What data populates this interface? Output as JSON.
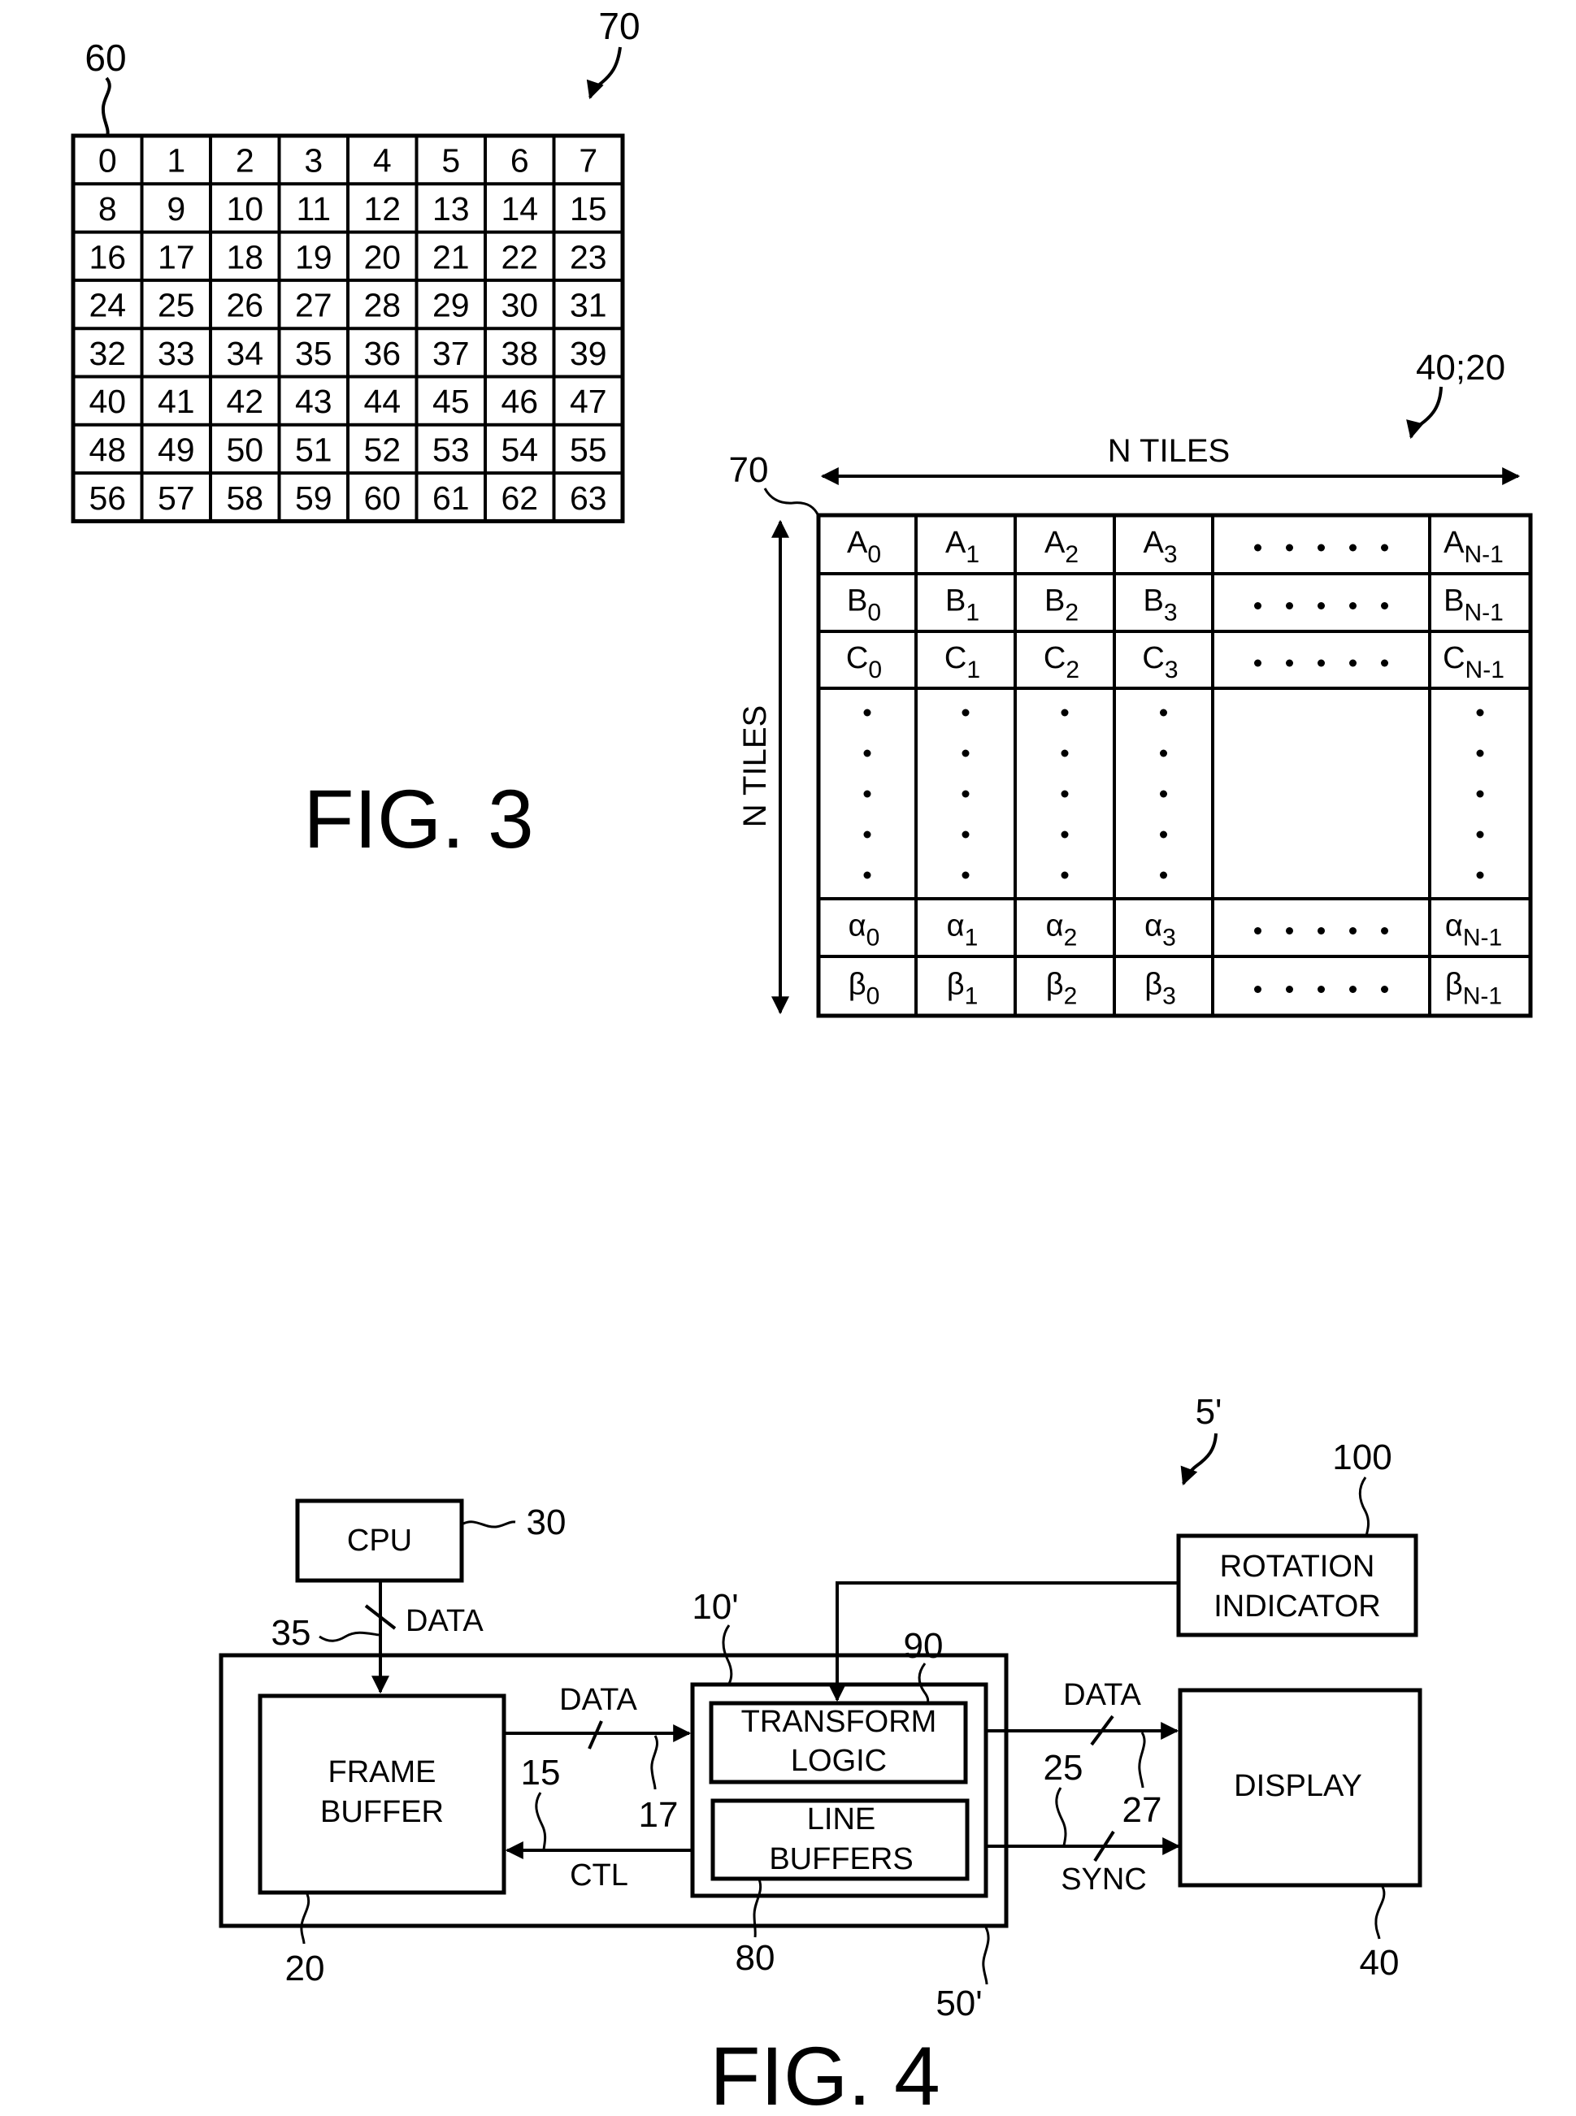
{
  "fig3": {
    "caption": "FIG. 3",
    "tile": {
      "ref_label": "60",
      "block_label": "70",
      "rows": [
        [
          "0",
          "1",
          "2",
          "3",
          "4",
          "5",
          "6",
          "7"
        ],
        [
          "8",
          "9",
          "10",
          "11",
          "12",
          "13",
          "14",
          "15"
        ],
        [
          "16",
          "17",
          "18",
          "19",
          "20",
          "21",
          "22",
          "23"
        ],
        [
          "24",
          "25",
          "26",
          "27",
          "28",
          "29",
          "30",
          "31"
        ],
        [
          "32",
          "33",
          "34",
          "35",
          "36",
          "37",
          "38",
          "39"
        ],
        [
          "40",
          "41",
          "42",
          "43",
          "44",
          "45",
          "46",
          "47"
        ],
        [
          "48",
          "49",
          "50",
          "51",
          "52",
          "53",
          "54",
          "55"
        ],
        [
          "56",
          "57",
          "58",
          "59",
          "60",
          "61",
          "62",
          "63"
        ]
      ]
    },
    "tile_array": {
      "ref_label": "40;20",
      "tile_label": "70",
      "width_label": "N TILES",
      "height_label": "N TILES",
      "ellipsis": "• • • • •",
      "rows": [
        {
          "type": "row",
          "cells": [
            {
              "base": "A",
              "sub": "0"
            },
            {
              "base": "A",
              "sub": "1"
            },
            {
              "base": "A",
              "sub": "2"
            },
            {
              "base": "A",
              "sub": "3"
            },
            {
              "base": "",
              "sub": "",
              "ellipsis": true
            },
            {
              "base": "A",
              "sub": "N-1"
            }
          ]
        },
        {
          "type": "row",
          "cells": [
            {
              "base": "B",
              "sub": "0"
            },
            {
              "base": "B",
              "sub": "1"
            },
            {
              "base": "B",
              "sub": "2"
            },
            {
              "base": "B",
              "sub": "3"
            },
            {
              "base": "",
              "sub": "",
              "ellipsis": true
            },
            {
              "base": "B",
              "sub": "N-1"
            }
          ]
        },
        {
          "type": "row",
          "cells": [
            {
              "base": "C",
              "sub": "0"
            },
            {
              "base": "C",
              "sub": "1"
            },
            {
              "base": "C",
              "sub": "2"
            },
            {
              "base": "C",
              "sub": "3"
            },
            {
              "base": "",
              "sub": "",
              "ellipsis": true
            },
            {
              "base": "C",
              "sub": "N-1"
            }
          ]
        },
        {
          "type": "vdots"
        },
        {
          "type": "row",
          "cells": [
            {
              "base": "α",
              "sub": "0"
            },
            {
              "base": "α",
              "sub": "1"
            },
            {
              "base": "α",
              "sub": "2"
            },
            {
              "base": "α",
              "sub": "3"
            },
            {
              "base": "",
              "sub": "",
              "ellipsis": true
            },
            {
              "base": "α",
              "sub": "N-1"
            }
          ]
        },
        {
          "type": "row",
          "cells": [
            {
              "base": "β",
              "sub": "0"
            },
            {
              "base": "β",
              "sub": "1"
            },
            {
              "base": "β",
              "sub": "2"
            },
            {
              "base": "β",
              "sub": "3"
            },
            {
              "base": "",
              "sub": "",
              "ellipsis": true
            },
            {
              "base": "β",
              "sub": "N-1"
            }
          ]
        }
      ]
    }
  },
  "fig4": {
    "caption": "FIG. 4",
    "system_label": "5'",
    "blocks": {
      "cpu": {
        "label": "CPU",
        "ref": "30"
      },
      "frame_buffer": {
        "line1": "FRAME",
        "line2": "BUFFER",
        "ref": "20"
      },
      "controller": {
        "ref": "10'"
      },
      "transform_logic": {
        "line1": "TRANSFORM",
        "line2": "LOGIC",
        "ref": "90"
      },
      "line_buffers": {
        "line1": "LINE",
        "line2": "BUFFERS",
        "ref": "80"
      },
      "memory_subsystem": {
        "ref": "50'"
      },
      "rotation_indicator": {
        "line1": "ROTATION",
        "line2": "INDICATOR",
        "ref": "100"
      },
      "display": {
        "label": "DISPLAY",
        "ref": "40"
      }
    },
    "signals": {
      "cpu_bus": {
        "label": "DATA",
        "ref": "35"
      },
      "fb_data": {
        "label": "DATA",
        "ref": "17"
      },
      "fb_ctl": {
        "label": "CTL",
        "ref": "15"
      },
      "disp_data": {
        "label": "DATA",
        "ref": "27"
      },
      "disp_sync": {
        "label": "SYNC",
        "ref": "25"
      }
    }
  }
}
